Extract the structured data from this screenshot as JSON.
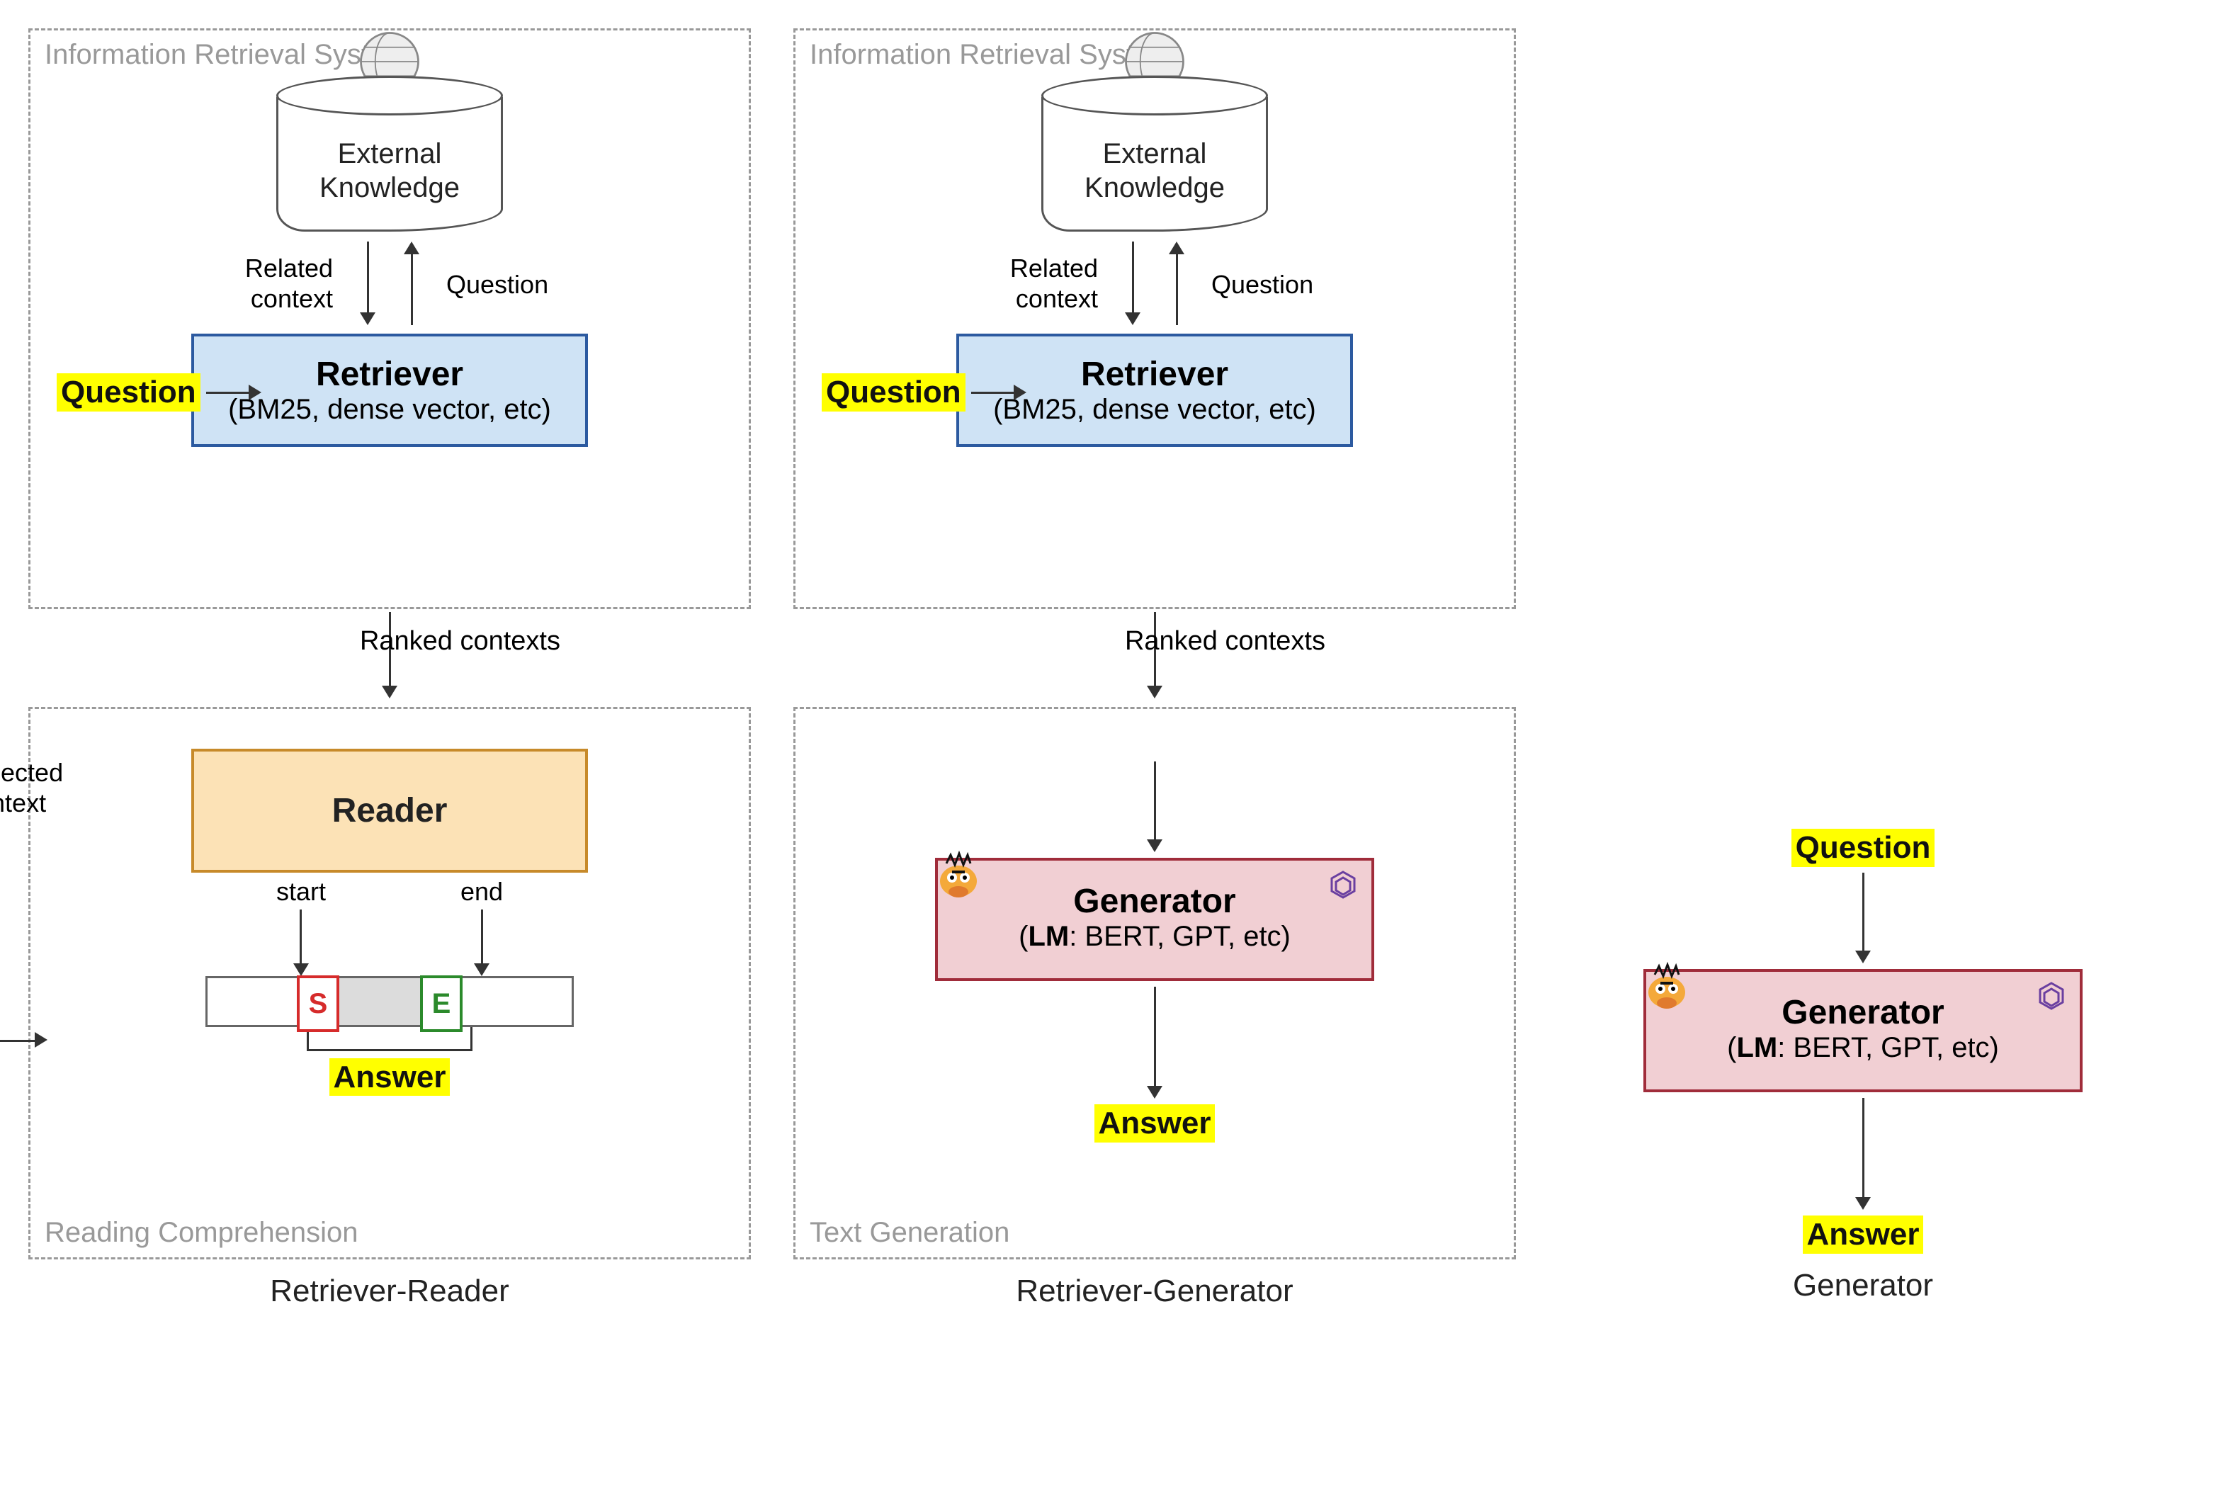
{
  "labels": {
    "ir_system": "Information Retrieval System",
    "external_knowledge": "External\nKnowledge",
    "related_context": "Related\ncontext",
    "question_arrow": "Question",
    "question": "Question",
    "retriever_title": "Retriever",
    "retriever_sub": "(BM25, dense vector, etc)",
    "ranked_contexts": "Ranked contexts",
    "reader_title": "Reader",
    "reading_comp": "Reading Comprehension",
    "selected_context": "Selected\ncontext",
    "start": "start",
    "end": "end",
    "tok_s": "S",
    "tok_e": "E",
    "answer": "Answer",
    "text_gen": "Text Generation",
    "generator_title": "Generator",
    "generator_sub_pre": "(",
    "generator_sub_lm": "LM",
    "generator_sub_rest": ": BERT, GPT, etc)",
    "col1_title": "Retriever-Reader",
    "col2_title": "Retriever-Generator",
    "col3_title": "Generator"
  }
}
